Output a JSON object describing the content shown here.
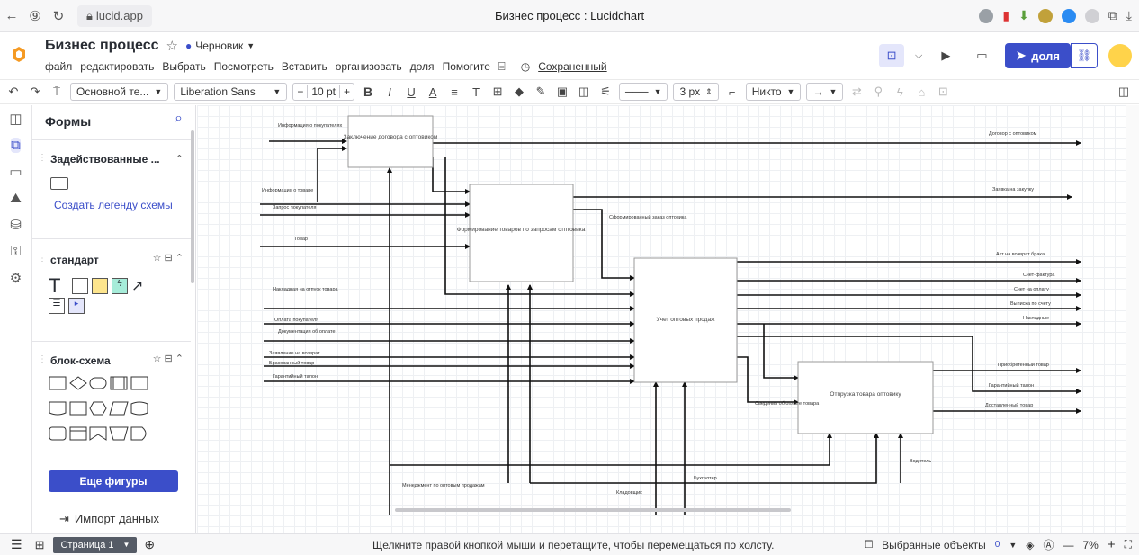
{
  "browser": {
    "url": "lucid.app",
    "title": "Бизнес процесс : Lucidchart"
  },
  "header": {
    "doc_title": "Бизнес процесс",
    "draft": "Черновик",
    "menus": [
      "файл",
      "редактировать",
      "Выбрать",
      "Посмотреть",
      "Вставить",
      "организовать",
      "доля",
      "Помогите"
    ],
    "saved": "Сохраненный",
    "share": "доля"
  },
  "toolbar": {
    "style": "Основной те...",
    "font": "Liberation Sans",
    "font_size": "10 pt",
    "line_width": "3 px",
    "line_end": "Никто"
  },
  "panel": {
    "title": "Формы",
    "section1": "Задействованные ...",
    "legend_link": "Создать легенду схемы",
    "section2": "стандарт",
    "section3": "блок-схема",
    "more_button": "Еще фигуры",
    "import": "Импорт данных"
  },
  "diagram": {
    "boxes": [
      "Заключение договора с оптовиком",
      "Формирование товаров по запросам отптовика",
      "Учет оптовых продаж",
      "Отпрузка товара оптовику"
    ],
    "inputs": [
      "Информация о покупателях",
      "Информация о товаре",
      "Запрос покупателя",
      "Товар",
      "Накладная на отпуск товара",
      "Оплата покупателя",
      "Документация об оплате",
      "Заявление на возврат",
      "Бракованный товар",
      "Гарантийный талон"
    ],
    "outputs": [
      "Договор с оптовиком",
      "Заявка на закупку",
      "Акт на возврат брака",
      "Счет-фактура",
      "Счет на оплату",
      "Выписка по счету",
      "Накладные",
      "Приобретенный товар",
      "Гарантийный талон",
      "Доставленный товар"
    ],
    "internal": [
      "Сформированный заказ оптовика",
      "Сведения об оплате товара"
    ],
    "mechanisms": [
      "Менеджмент по оптовым продажам",
      "Кладовщик",
      "Бухгалтер",
      "Водитель"
    ]
  },
  "status": {
    "page": "Страница 1",
    "hint": "Щелкните правой кнопкой мыши и перетащите, чтобы перемещаться по холсту.",
    "selected": "Выбранные объекты",
    "selected_count": "0",
    "zoom": "7%"
  }
}
